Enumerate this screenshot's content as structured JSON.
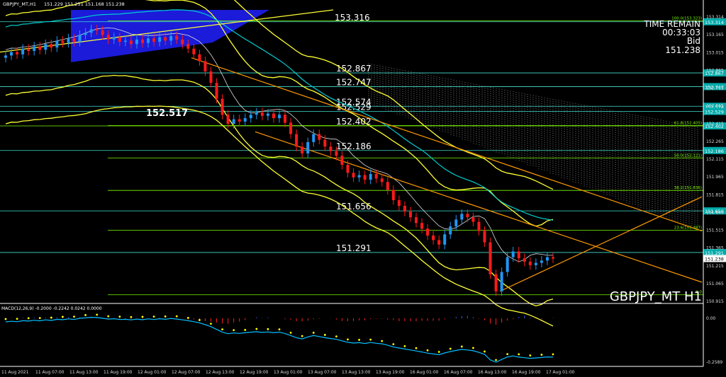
{
  "header": {
    "symbol_info": "GBPJPY_MT,H1",
    "ohlc": "151.229 151.251 151.168 151.238"
  },
  "info_panel": {
    "time_remain_label": "TIME REMAIN",
    "time_remain_value": "00:33:03",
    "bid_label": "Bid",
    "bid_value": "151.238"
  },
  "watermark": "GBPJPY_MT H1",
  "macd_label": "MACD(12,26,9) -0.2000 -0.2242 0.0242 0.0000",
  "levels": [
    {
      "price": 153.316,
      "label": "153.316",
      "tag": "153.314",
      "color": "#40e0d0"
    },
    {
      "price": 152.867,
      "label": "152.867",
      "tag": "152.867",
      "color": "#40e0d0"
    },
    {
      "price": 152.747,
      "label": "152.747",
      "tag": "152.747",
      "color": "#40e0d0"
    },
    {
      "price": 152.574,
      "label": "152.574",
      "tag": "152.574",
      "color": "#40e0d0"
    },
    {
      "price": 152.529,
      "label": "152.529",
      "tag": "152.529",
      "color": "#40e0d0"
    },
    {
      "price": 152.402,
      "label": "152.402",
      "tag": "152.402",
      "color": "#7cfc00"
    },
    {
      "price": 152.186,
      "label": "152.186",
      "tag": "152.186",
      "color": "#40e0d0"
    },
    {
      "price": 151.656,
      "label": "151.656",
      "tag": "151.656",
      "color": "#40e0d0"
    },
    {
      "price": 151.291,
      "label": "151.291",
      "tag": "151.291",
      "color": "#40e0d0"
    }
  ],
  "special_label": "152.517",
  "fib_levels": [
    {
      "price": 153.323,
      "label": "100.0(153.323)"
    },
    {
      "price": 152.405,
      "label": "61.8(152.405)"
    },
    {
      "price": 152.121,
      "label": "50.0(152.121)"
    },
    {
      "price": 151.836,
      "label": "38.2(151.836)"
    },
    {
      "price": 151.487,
      "label": "23.6(151.487)"
    },
    {
      "price": 150.92,
      "label": "0.0"
    }
  ],
  "price_axis": {
    "min": 150.85,
    "max": 153.42,
    "ticks": [
      "153.314",
      "153.165",
      "153.015",
      "152.865",
      "152.715",
      "152.565",
      "152.415",
      "152.265",
      "152.115",
      "151.965",
      "151.815",
      "151.665",
      "151.515",
      "151.365",
      "151.215",
      "151.065",
      "150.915"
    ],
    "current_tag": "151.238"
  },
  "macd_axis": {
    "ticks": [
      "0.00",
      "-0.2589"
    ]
  },
  "time_axis": {
    "labels": [
      "11 Aug 2021",
      "11 Aug 07:00",
      "11 Aug 13:00",
      "11 Aug 19:00",
      "12 Aug 01:00",
      "12 Aug 07:00",
      "12 Aug 13:00",
      "12 Aug 19:00",
      "13 Aug 01:00",
      "13 Aug 07:00",
      "13 Aug 13:00",
      "13 Aug 19:00",
      "16 Aug 01:00",
      "16 Aug 07:00",
      "16 Aug 13:00",
      "16 Aug 19:00",
      "17 Aug 01:00"
    ]
  },
  "colors": {
    "bull": "#2196f3",
    "bear": "#ff1a1a",
    "band": "#ffff33",
    "cloud": "#2020ff",
    "trend": "#ff9900",
    "macd_line": "#00bfff",
    "signal": "#ffff00"
  },
  "chart_data": {
    "type": "candlestick",
    "closes": [
      153.02,
      153.05,
      153.03,
      153.08,
      153.06,
      153.1,
      153.07,
      153.12,
      153.09,
      153.15,
      153.13,
      153.17,
      153.14,
      153.2,
      153.22,
      153.25,
      153.24,
      153.2,
      153.16,
      153.18,
      153.14,
      153.15,
      153.12,
      153.16,
      153.13,
      153.17,
      153.14,
      153.18,
      153.15,
      153.19,
      153.16,
      153.12,
      153.08,
      153.03,
      152.97,
      152.88,
      152.78,
      152.64,
      152.5,
      152.42,
      152.46,
      152.44,
      152.47,
      152.5,
      152.52,
      152.49,
      152.51,
      152.47,
      152.5,
      152.43,
      152.33,
      152.22,
      152.16,
      152.26,
      152.33,
      152.28,
      152.22,
      152.18,
      152.14,
      152.06,
      151.99,
      151.95,
      151.97,
      151.93,
      151.98,
      151.94,
      151.91,
      151.84,
      151.75,
      151.7,
      151.65,
      151.6,
      151.55,
      151.5,
      151.44,
      151.4,
      151.36,
      151.45,
      151.52,
      151.58,
      151.63,
      151.6,
      151.56,
      151.48,
      151.38,
      151.1,
      150.95,
      151.12,
      151.25,
      151.3,
      151.24,
      151.21,
      151.18,
      151.2,
      151.22,
      151.25,
      151.238
    ]
  }
}
